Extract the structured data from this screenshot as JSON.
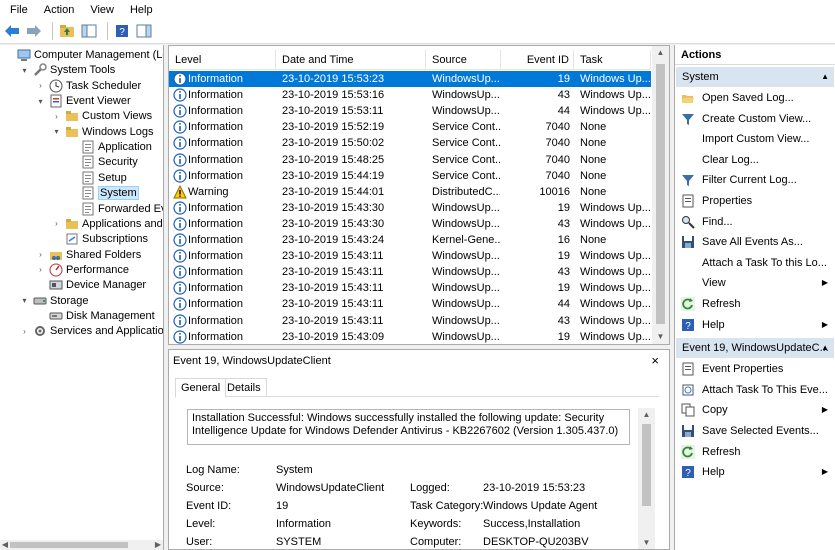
{
  "menu": [
    "File",
    "Action",
    "View",
    "Help"
  ],
  "tree": [
    {
      "label": "Computer Management (Local",
      "depth": 0,
      "tw": "",
      "icon": "computer-icon"
    },
    {
      "label": "System Tools",
      "depth": 1,
      "tw": "▾",
      "icon": "tools-icon"
    },
    {
      "label": "Task Scheduler",
      "depth": 2,
      "tw": "›",
      "icon": "clock-icon"
    },
    {
      "label": "Event Viewer",
      "depth": 2,
      "tw": "▾",
      "icon": "event-viewer-icon"
    },
    {
      "label": "Custom Views",
      "depth": 3,
      "tw": "›",
      "icon": "folder-icon"
    },
    {
      "label": "Windows Logs",
      "depth": 3,
      "tw": "▾",
      "icon": "folder-icon"
    },
    {
      "label": "Application",
      "depth": 4,
      "tw": "",
      "icon": "log-icon"
    },
    {
      "label": "Security",
      "depth": 4,
      "tw": "",
      "icon": "log-icon"
    },
    {
      "label": "Setup",
      "depth": 4,
      "tw": "",
      "icon": "log-icon"
    },
    {
      "label": "System",
      "depth": 4,
      "tw": "",
      "icon": "log-icon",
      "selected": true
    },
    {
      "label": "Forwarded Event",
      "depth": 4,
      "tw": "",
      "icon": "log-icon"
    },
    {
      "label": "Applications and Se",
      "depth": 3,
      "tw": "›",
      "icon": "folder-icon"
    },
    {
      "label": "Subscriptions",
      "depth": 3,
      "tw": "",
      "icon": "subscription-icon"
    },
    {
      "label": "Shared Folders",
      "depth": 2,
      "tw": "›",
      "icon": "shared-folder-icon"
    },
    {
      "label": "Performance",
      "depth": 2,
      "tw": "›",
      "icon": "performance-icon"
    },
    {
      "label": "Device Manager",
      "depth": 2,
      "tw": "",
      "icon": "device-manager-icon"
    },
    {
      "label": "Storage",
      "depth": 1,
      "tw": "▾",
      "icon": "storage-icon"
    },
    {
      "label": "Disk Management",
      "depth": 2,
      "tw": "",
      "icon": "disk-icon"
    },
    {
      "label": "Services and Applications",
      "depth": 1,
      "tw": "›",
      "icon": "services-icon"
    }
  ],
  "columns": [
    "Level",
    "Date and Time",
    "Source",
    "Event ID",
    "Task Category"
  ],
  "events": [
    {
      "level": "Information",
      "date": "23-10-2019 15:53:23",
      "source": "WindowsUp...",
      "id": "19",
      "category": "Windows Up...",
      "selected": true
    },
    {
      "level": "Information",
      "date": "23-10-2019 15:53:16",
      "source": "WindowsUp...",
      "id": "43",
      "category": "Windows Up..."
    },
    {
      "level": "Information",
      "date": "23-10-2019 15:53:11",
      "source": "WindowsUp...",
      "id": "44",
      "category": "Windows Up..."
    },
    {
      "level": "Information",
      "date": "23-10-2019 15:52:19",
      "source": "Service Cont...",
      "id": "7040",
      "category": "None"
    },
    {
      "level": "Information",
      "date": "23-10-2019 15:50:02",
      "source": "Service Cont...",
      "id": "7040",
      "category": "None"
    },
    {
      "level": "Information",
      "date": "23-10-2019 15:48:25",
      "source": "Service Cont...",
      "id": "7040",
      "category": "None"
    },
    {
      "level": "Information",
      "date": "23-10-2019 15:44:19",
      "source": "Service Cont...",
      "id": "7040",
      "category": "None"
    },
    {
      "level": "Warning",
      "date": "23-10-2019 15:44:01",
      "source": "DistributedC...",
      "id": "10016",
      "category": "None"
    },
    {
      "level": "Information",
      "date": "23-10-2019 15:43:30",
      "source": "WindowsUp...",
      "id": "19",
      "category": "Windows Up..."
    },
    {
      "level": "Information",
      "date": "23-10-2019 15:43:30",
      "source": "WindowsUp...",
      "id": "43",
      "category": "Windows Up..."
    },
    {
      "level": "Information",
      "date": "23-10-2019 15:43:24",
      "source": "Kernel-Gene...",
      "id": "16",
      "category": "None"
    },
    {
      "level": "Information",
      "date": "23-10-2019 15:43:11",
      "source": "WindowsUp...",
      "id": "19",
      "category": "Windows Up..."
    },
    {
      "level": "Information",
      "date": "23-10-2019 15:43:11",
      "source": "WindowsUp...",
      "id": "43",
      "category": "Windows Up..."
    },
    {
      "level": "Information",
      "date": "23-10-2019 15:43:11",
      "source": "WindowsUp...",
      "id": "19",
      "category": "Windows Up..."
    },
    {
      "level": "Information",
      "date": "23-10-2019 15:43:11",
      "source": "WindowsUp...",
      "id": "44",
      "category": "Windows Up..."
    },
    {
      "level": "Information",
      "date": "23-10-2019 15:43:11",
      "source": "WindowsUp...",
      "id": "43",
      "category": "Windows Up..."
    },
    {
      "level": "Information",
      "date": "23-10-2019 15:43:09",
      "source": "WindowsUp...",
      "id": "19",
      "category": "Windows Up..."
    }
  ],
  "details": {
    "title": "Event 19, WindowsUpdateClient",
    "close": "×",
    "tabs": [
      "General",
      "Details"
    ],
    "message": "Installation Successful: Windows successfully installed the following update: Security Intelligence Update for Windows Defender Antivirus - KB2267602 (Version 1.305.437.0)",
    "left_props": [
      {
        "label": "Log Name:",
        "value": "System"
      },
      {
        "label": "Source:",
        "value": "WindowsUpdateClient"
      },
      {
        "label": "Event ID:",
        "value": "19"
      },
      {
        "label": "Level:",
        "value": "Information"
      },
      {
        "label": "User:",
        "value": "SYSTEM"
      }
    ],
    "right_props": [
      {
        "label": "Logged:",
        "value": "23-10-2019 15:53:23"
      },
      {
        "label": "Task Category:",
        "value": "Windows Update Agent"
      },
      {
        "label": "Keywords:",
        "value": "Success,Installation"
      },
      {
        "label": "Computer:",
        "value": "DESKTOP-QU203BV"
      }
    ]
  },
  "actions": {
    "title": "Actions",
    "sections": [
      {
        "name": "System",
        "items": [
          {
            "label": "Open Saved Log...",
            "icon": "open-folder-icon",
            "sub": false
          },
          {
            "label": "Create Custom View...",
            "icon": "filter-icon",
            "sub": false
          },
          {
            "label": "Import Custom View...",
            "icon": "",
            "sub": false
          },
          {
            "label": "Clear Log...",
            "icon": "",
            "sub": false
          },
          {
            "label": "Filter Current Log...",
            "icon": "filter-icon",
            "sub": false
          },
          {
            "label": "Properties",
            "icon": "properties-icon",
            "sub": false
          },
          {
            "label": "Find...",
            "icon": "find-icon",
            "sub": false
          },
          {
            "label": "Save All Events As...",
            "icon": "save-icon",
            "sub": false
          },
          {
            "label": "Attach a Task To this Lo...",
            "icon": "",
            "sub": false
          },
          {
            "label": "View",
            "icon": "",
            "sub": true
          },
          {
            "label": "Refresh",
            "icon": "refresh-icon",
            "sub": false
          },
          {
            "label": "Help",
            "icon": "help-icon",
            "sub": true
          }
        ]
      },
      {
        "name": "Event 19, WindowsUpdateC...",
        "items": [
          {
            "label": "Event Properties",
            "icon": "event-properties-icon",
            "sub": false
          },
          {
            "label": "Attach Task To This Eve...",
            "icon": "attach-task-icon",
            "sub": false
          },
          {
            "label": "Copy",
            "icon": "copy-icon",
            "sub": true
          },
          {
            "label": "Save Selected Events...",
            "icon": "save-icon",
            "sub": false
          },
          {
            "label": "Refresh",
            "icon": "refresh-icon",
            "sub": false
          },
          {
            "label": "Help",
            "icon": "help-icon",
            "sub": true
          }
        ]
      }
    ]
  }
}
